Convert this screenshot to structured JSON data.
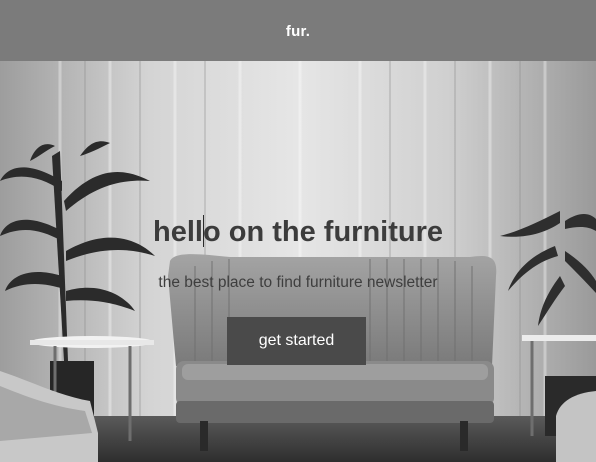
{
  "header": {
    "logo": "fur."
  },
  "hero": {
    "headline_before_caret": "hell",
    "headline_after_caret": "o on the furniture",
    "subheadline": "the best place to find furniture newsletter",
    "cta_label": "get started"
  },
  "colors": {
    "header_bg": "#7b7b7b",
    "button_bg": "#4a4a4a",
    "headline_text": "#3c3c3c"
  }
}
